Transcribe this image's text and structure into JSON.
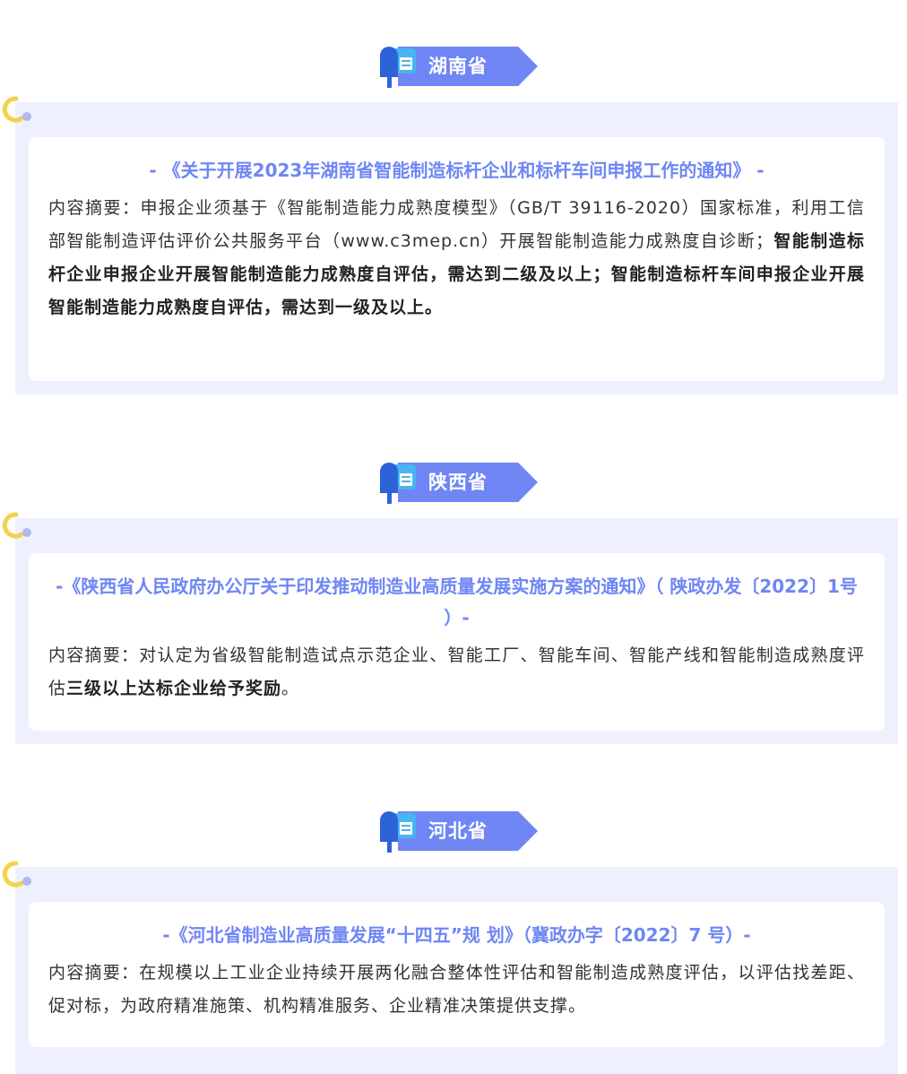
{
  "sections": [
    {
      "province": "湖南省",
      "title": "- 《关于开展2023年湖南省智能制造标杆企业和标杆车间申报工作的通知》 -",
      "summary_label": "内容摘要：",
      "summary_normal": "申报企业须基于《智能制造能力成熟度模型》（GB/T 39116-2020）国家标准，利用工信部智能制造评估评价公共服务平台（www.c3mep.cn）开展智能制造能力成熟度自诊断；",
      "summary_bold": "智能制造标杆企业申报企业开展智能制造能力成熟度自评估，需达到二级及以上；智能制造标杆车间申报企业开展智能制造能力成熟度自评估，需达到一级及以上。",
      "summary_tail": ""
    },
    {
      "province": "陕西省",
      "title": "-《陕西省人民政府办公厅关于印发推动制造业高质量发展实施方案的通知》（ 陕政办发〔2022〕1号 ）-",
      "summary_label": "内容摘要：",
      "summary_normal": "对认定为省级智能制造试点示范企业、智能工厂、智能车间、智能产线和智能制造成熟度评估",
      "summary_bold": "三级以上达标企业给予奖励",
      "summary_tail": "。"
    },
    {
      "province": "河北省",
      "title": "-《河北省制造业高质量发展“十四五”规 划》（冀政办字〔2022〕7 号）-",
      "summary_label": "内容摘要：",
      "summary_normal": "在规模以上工业企业持续开展两化融合整体性评估和智能制造成熟度评估，以评估找差距、促对标，为政府精准施策、机构精准服务、企业精准决策提供支撑。",
      "summary_bold": "",
      "summary_tail": ""
    }
  ],
  "colors": {
    "accent": "#6f86f4",
    "panel": "#eef1fd",
    "hook": "#f3d34a",
    "text": "#333333"
  },
  "icons": {
    "tag": "mailbox-icon",
    "corner": "hook-icon"
  }
}
